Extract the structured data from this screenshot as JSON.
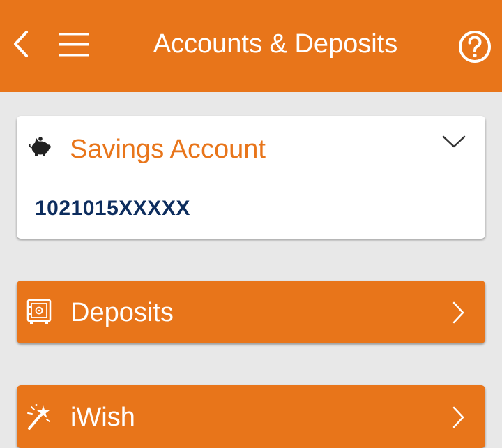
{
  "header": {
    "title": "Accounts & Deposits",
    "back_icon": "chevron-left-icon",
    "menu_icon": "hamburger-menu-icon",
    "help_icon": "question-circle-icon",
    "background_color": "#e8751a"
  },
  "account_card": {
    "icon": "piggy-bank-icon",
    "type_label": "Savings Account",
    "account_number": "1021015XXXXX",
    "expand_icon": "chevron-down-icon"
  },
  "nav_items": [
    {
      "label": "Deposits",
      "icon": "safe-icon",
      "arrow_icon": "chevron-right-icon"
    },
    {
      "label": "iWish",
      "icon": "magic-wand-icon",
      "arrow_icon": "chevron-right-icon"
    }
  ],
  "colors": {
    "accent": "#e8751a",
    "page_background": "#e8e8e8",
    "account_number": "#0d2d5e"
  }
}
